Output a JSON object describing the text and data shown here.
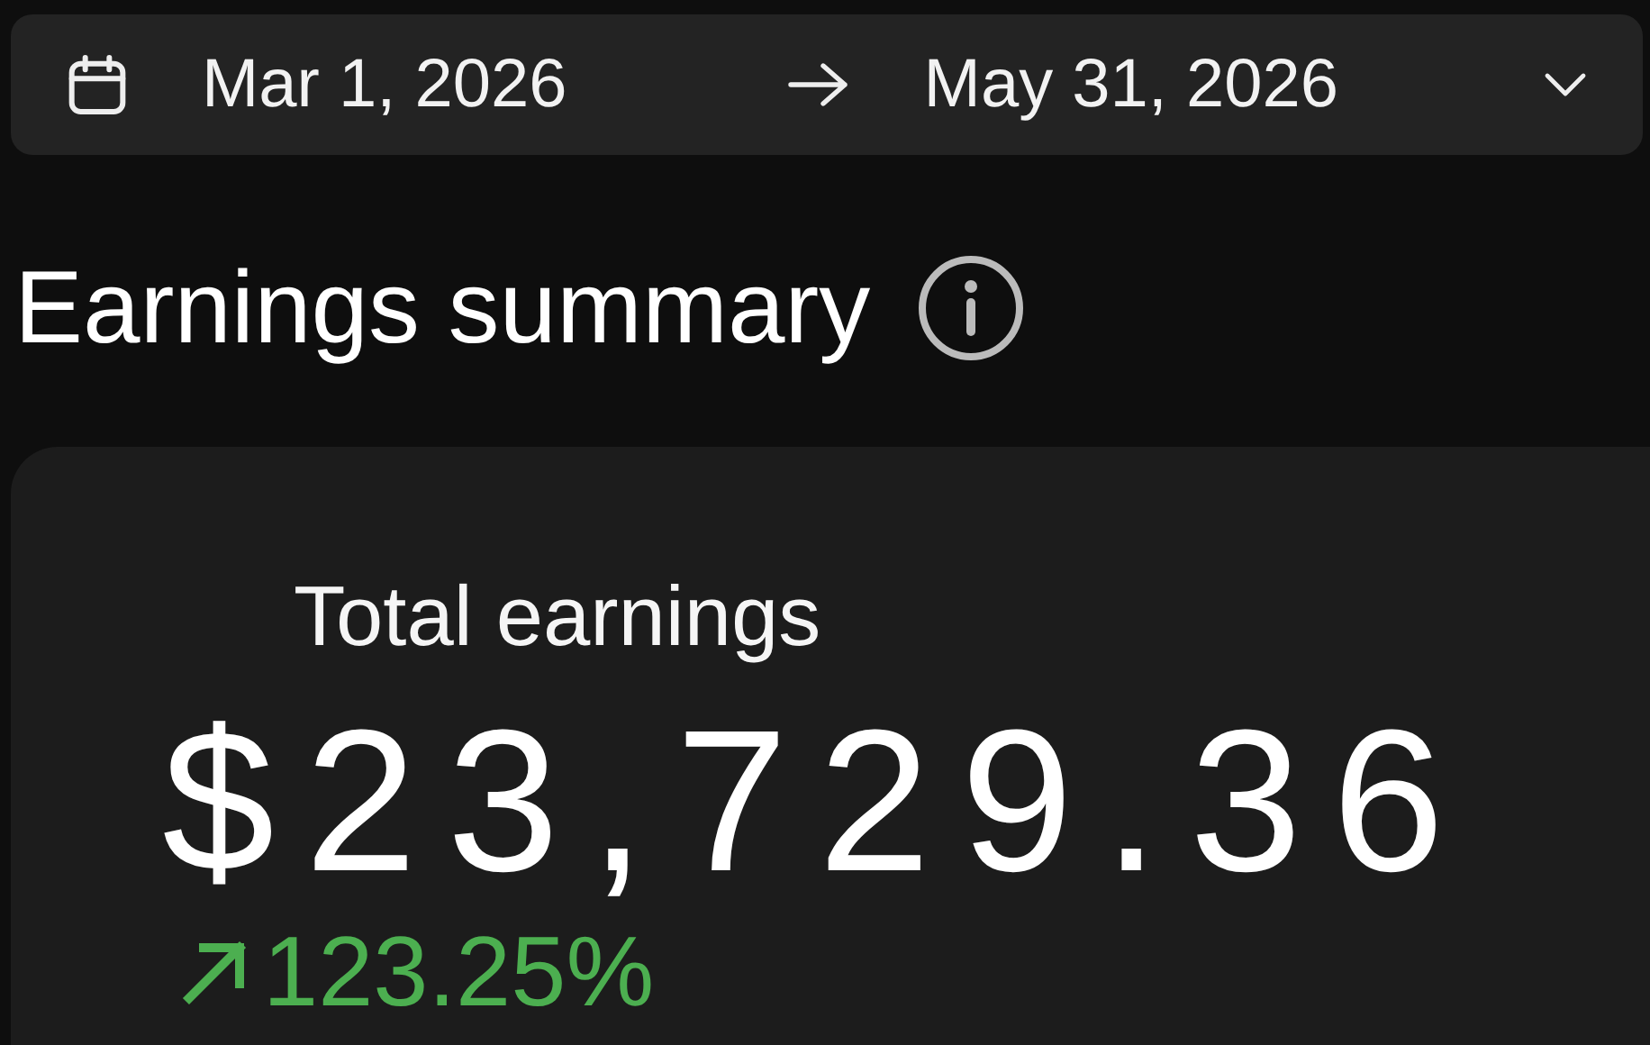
{
  "date_range": {
    "start": "Mar 1, 2026",
    "end": "May 31, 2026"
  },
  "heading": "Earnings summary",
  "card": {
    "label": "Total earnings",
    "amount": "$23,729.36",
    "change": "123.25%",
    "rising": true
  }
}
